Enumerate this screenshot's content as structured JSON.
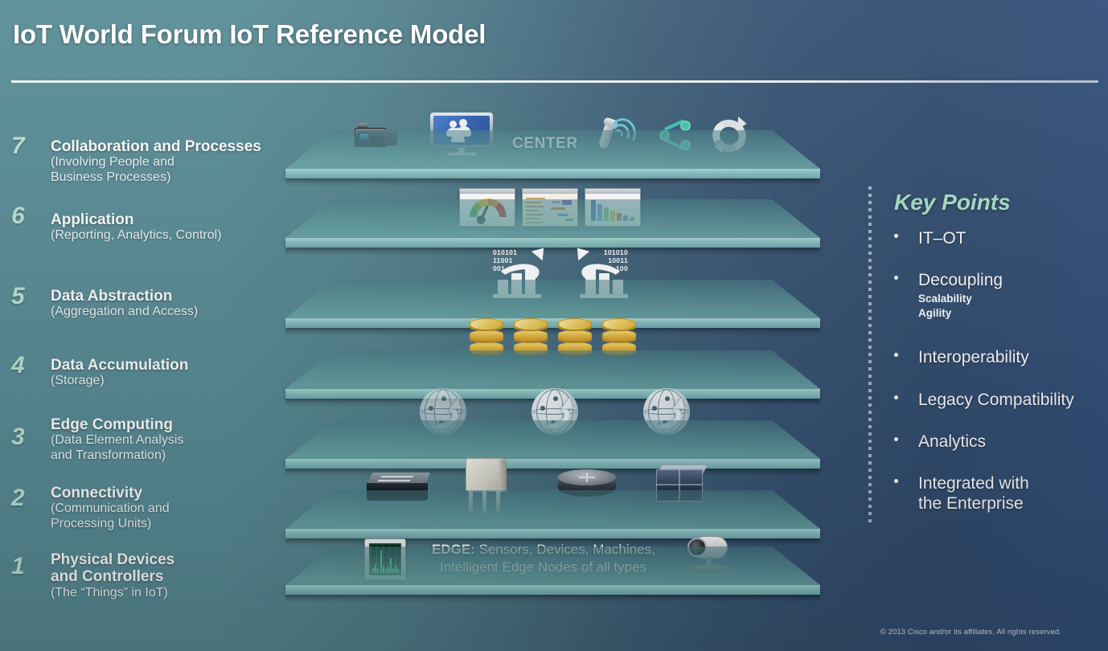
{
  "header": {
    "title": "IoT World Forum IoT Reference Model"
  },
  "layers": [
    {
      "number": "7",
      "title": "Collaboration and Processes",
      "subtitle": "(Involving People and\nBusiness Processes)",
      "deck_label": "CENTER",
      "icons": [
        "camcorder-icon",
        "monitor-people-icon",
        "phone-signal-icon",
        "share-nodes-icon",
        "sync-arrows-icon"
      ]
    },
    {
      "number": "6",
      "title": "Application",
      "subtitle": "(Reporting, Analytics, Control)",
      "icons": [
        "gauge-dashboard-icon",
        "report-dashboard-icon",
        "bar-chart-dashboard-icon"
      ]
    },
    {
      "number": "5",
      "title": "Data Abstraction",
      "subtitle": "(Aggregation and Access)",
      "icons": [
        "data-growth-chart-icon",
        "data-growth-chart-mirrored-icon"
      ],
      "binary_left": "010101\n11001\n001",
      "binary_right": "101010\n10011\n100"
    },
    {
      "number": "4",
      "title": "Data Accumulation",
      "subtitle": "(Storage)",
      "icons": [
        "database-icon",
        "database-icon",
        "database-icon",
        "database-icon"
      ]
    },
    {
      "number": "3",
      "title": "Edge Computing",
      "subtitle": "(Data Element Analysis\nand Transformation)",
      "icons": [
        "globe-network-icon",
        "globe-network-icon",
        "globe-network-icon"
      ]
    },
    {
      "number": "2",
      "title": "Connectivity",
      "subtitle": "(Communication and\nProcessing Units)",
      "icons": [
        "network-switch-icon",
        "wireless-access-point-icon",
        "router-icon",
        "server-icon"
      ]
    },
    {
      "number": "1",
      "title": "Physical Devices\nand Controllers",
      "subtitle": "(The “Things” in IoT)",
      "deck_label_bold": "EDGE:",
      "deck_label_rest": " Sensors, Devices, Machines,",
      "deck_label_line2": "Intelligent Edge Nodes of all types",
      "icons": [
        "sensor-panel-icon",
        "ip-camera-icon"
      ]
    }
  ],
  "key_points": {
    "title": "Key Points",
    "items": [
      {
        "label": "IT–OT",
        "subs": []
      },
      {
        "label": "Decoupling",
        "subs": [
          "Scalability",
          "Agility"
        ]
      },
      {
        "label": "Interoperability",
        "subs": []
      },
      {
        "label": "Legacy Compatibility",
        "subs": []
      },
      {
        "label": "Analytics",
        "subs": []
      },
      {
        "label": "Integrated with\nthe Enterprise",
        "subs": []
      }
    ]
  },
  "footer": {
    "copyright": "© 2013 Cisco and/or its affiliates. All rights reserved."
  },
  "colors": {
    "bg_left": "#5a8d97",
    "bg_right": "#334e70",
    "plank": "#8cc2c4",
    "accent_green": "#a8e0c7",
    "gold": "#e3b53c"
  }
}
